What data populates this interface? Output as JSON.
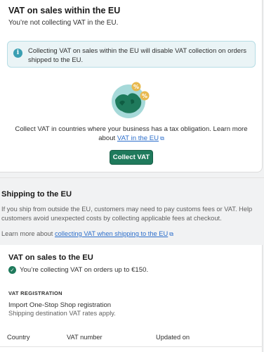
{
  "vat_card": {
    "title": "VAT on sales within the EU",
    "subtitle": "You’re not collecting VAT in the EU.",
    "banner_text": "Collecting VAT on sales within the EU will disable VAT collection on orders shipped to the EU.",
    "banner_icon": "info-icon",
    "collect_text": "Collect VAT in countries where your business has a tax obligation. Learn more about ",
    "collect_link": "VAT in the EU",
    "collect_button": "Collect VAT",
    "illustration": "eu-map-illustration"
  },
  "shipping_section": {
    "title": "Shipping to the EU",
    "description": "If you ship from outside the EU, customers may need to pay customs fees or VAT. Help customers avoid unexpected costs by collecting applicable fees at checkout.",
    "learn_prefix": "Learn more about ",
    "learn_link": "collecting VAT when shipping to the EU"
  },
  "shipping_card": {
    "title": "VAT on sales to the EU",
    "status_text": "You’re collecting VAT on orders up to €150.",
    "registration_label": "VAT REGISTRATION",
    "registration_name": "Import One-Stop Shop registration",
    "registration_desc": "Shipping destination VAT rates apply.",
    "columns": [
      "Country",
      "VAT number",
      "Updated on"
    ]
  },
  "colors": {
    "primary_button": "#1f7a5c",
    "link": "#2c6ecb",
    "banner_bg": "#eaf4f6",
    "info": "#3a9fb2"
  }
}
